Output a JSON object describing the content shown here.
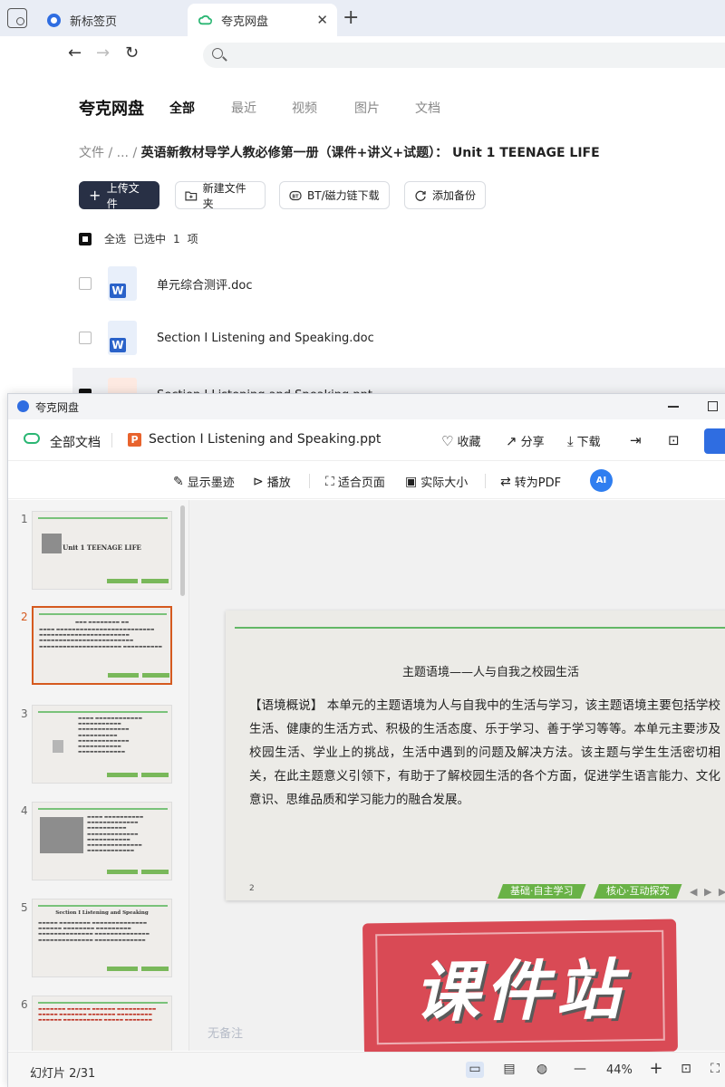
{
  "browser": {
    "tabs": [
      {
        "label": "新标签页",
        "active": false
      },
      {
        "label": "夸克网盘",
        "active": true
      }
    ],
    "close_glyph": "✕",
    "newtab_glyph": "+",
    "back_glyph": "←",
    "forward_glyph": "→",
    "reload_glyph": "↻"
  },
  "disk": {
    "brand": "夸克网盘",
    "nav_tabs": [
      "全部",
      "最近",
      "视频",
      "图片",
      "文档"
    ],
    "breadcrumb": {
      "root": "文件",
      "sep": "/",
      "ellipsis": "...",
      "current": "英语新教材导学人教必修第一册（课件+讲义+试题）： Unit 1 TEENAGE LIFE"
    },
    "buttons": {
      "upload": "上传文件",
      "new_folder": "新建文件夹",
      "bt": "BT/磁力链下载",
      "backup": "添加备份"
    },
    "select_all": "全选",
    "selected_prefix": "已选中",
    "selected_count": "1",
    "selected_unit": "项",
    "files": [
      {
        "name": "单元综合测评.doc",
        "type": "word",
        "checked": false
      },
      {
        "name": "Section Ⅰ Listening and Speaking.doc",
        "type": "word",
        "checked": false
      },
      {
        "name": "Section Ⅰ Listening and Speaking.ppt",
        "type": "ppt",
        "checked": true
      }
    ]
  },
  "viewer": {
    "window_title": "夸克网盘",
    "all_docs": "全部文档",
    "doc_name": "Section Ⅰ Listening and Speaking.ppt",
    "ppt_badge": "P",
    "actions": {
      "favorite": "收藏",
      "share": "分享",
      "download": "下载"
    },
    "tools": {
      "ink": "显示墨迹",
      "play": "播放",
      "fit": "适合页面",
      "actual": "实际大小",
      "to_pdf": "转为PDF",
      "ai": "AI"
    },
    "thumbnails": [
      {
        "num": "1",
        "title": "Unit 1   TEENAGE LIFE"
      },
      {
        "num": "2",
        "title": ""
      },
      {
        "num": "3",
        "title": ""
      },
      {
        "num": "4",
        "title": ""
      },
      {
        "num": "5",
        "title": "Section Ⅰ   Listening and Speaking"
      },
      {
        "num": "6",
        "title": ""
      }
    ],
    "slide": {
      "title": "主题语境——人与自我之校园生活",
      "body": "【语境概说】 本单元的主题语境为人与自我中的生活与学习，该主题语境主要包括学校生活、健康的生活方式、积极的生活态度、乐于学习、善于学习等等。本单元主要涉及校园生活、学业上的挑战，生活中遇到的问题及解决方法。该主题与学生生活密切相关，在此主题意义引领下，有助于了解校园生活的各个方面，促进学生语言能力、文化意识、思维品质和学习能力的融合发展。",
      "page_number": "2",
      "chips": [
        "基础·自主学习",
        "核心·互动探究"
      ],
      "arrows": "◀ ▶ ▶"
    },
    "notes_placeholder": "无备注",
    "stamp_text": "课件站",
    "status": {
      "slide_counter": "幻灯片 2/31",
      "zoom": "44%",
      "zoom_out": "—",
      "zoom_in": "+"
    }
  }
}
